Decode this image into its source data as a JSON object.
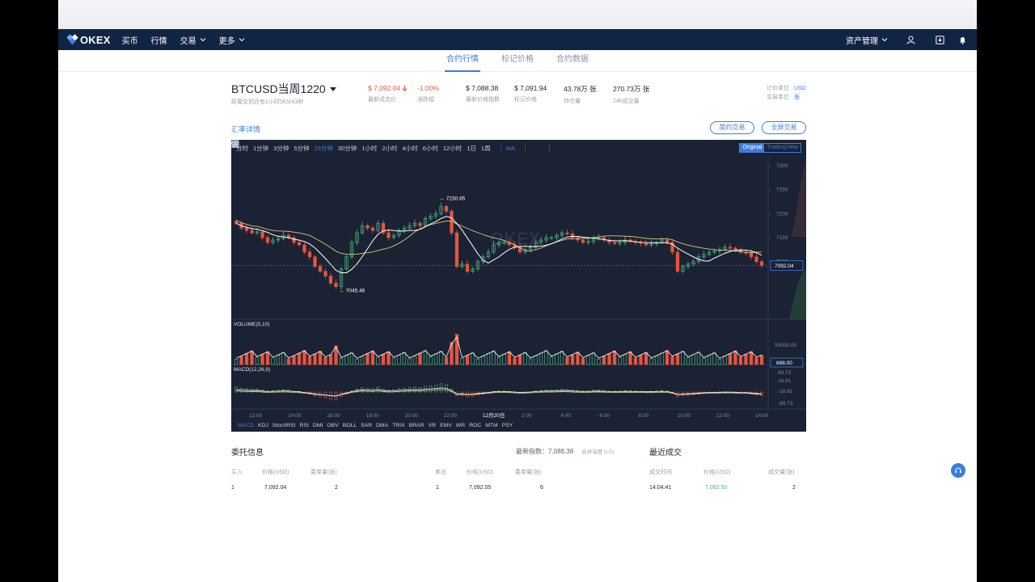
{
  "nav": {
    "logo": "OKEX",
    "items": [
      "买币",
      "行情",
      "交易",
      "更多"
    ],
    "asset_label": "资产管理"
  },
  "subtabs": [
    "合约行情",
    "标记价格",
    "合约数据"
  ],
  "ticker": {
    "symbol": "BTCUSD当周1220",
    "delivery": "距离交割还有1小时56分43秒",
    "stats": [
      {
        "value": "$ 7,092.04",
        "label": "最新成交价"
      },
      {
        "value": "-1.00%",
        "label": "涨跌幅"
      },
      {
        "value": "$ 7,088.38",
        "label": "最新价格指数"
      },
      {
        "value": "$ 7,091.94",
        "label": "标记价格"
      },
      {
        "value": "43.78万 张",
        "label": "持仓量"
      },
      {
        "value": "270.73万 张",
        "label": "24h成交量"
      }
    ],
    "price_unit_label": "计价单位",
    "price_unit": "USD",
    "trade_unit_label": "交易单位",
    "trade_unit": "张"
  },
  "links": {
    "rates": "汇率详情",
    "simple": "简约交易",
    "fullscreen": "全屏交易"
  },
  "chart": {
    "timeframes": [
      "分时",
      "1分钟",
      "3分钟",
      "5分钟",
      "15分钟",
      "30分钟",
      "1小时",
      "2小时",
      "4小时",
      "6小时",
      "12小时",
      "1日",
      "1周"
    ],
    "active_timeframe": "15分钟",
    "ma_label": "MA",
    "view_original": "Original",
    "view_tradingview": "TradingView",
    "volume_label": "VOLUME(5,10)",
    "macd_label": "MACD(12,26,9)",
    "date_label": "12月20日",
    "indicators": [
      "MACD",
      "KDJ",
      "StochRSI",
      "RSI",
      "DMI",
      "OBV",
      "BOLL",
      "SAR",
      "DMA",
      "TRIX",
      "BRAR",
      "VR",
      "EMV",
      "WR",
      "ROC",
      "MTM",
      "PSY"
    ],
    "watermark": "OKEX",
    "colors": {
      "up": "#4fb382",
      "down": "#e55541",
      "accent": "#3b7ddd",
      "bg": "#1a2233"
    }
  },
  "chart_data": {
    "type": "candlestick",
    "ylabel": "",
    "ylim": [
      6980,
      7320
    ],
    "y_ticks": [
      7300,
      7250,
      7200,
      7150,
      7100
    ],
    "x_ticks": [
      "12:00",
      "14:00",
      "16:00",
      "18:00",
      "20:00",
      "22:00",
      "12月20日",
      "2:00",
      "4:00",
      "6:00",
      "8:00",
      "10:00",
      "12:00",
      "14:00"
    ],
    "last_price": "7092.04",
    "high_marker": "7230.65",
    "low_marker": "7045.46",
    "close_values": [
      7180,
      7170,
      7165,
      7160,
      7162,
      7150,
      7140,
      7145,
      7148,
      7155,
      7150,
      7140,
      7135,
      7120,
      7110,
      7090,
      7080,
      7070,
      7055,
      7048,
      7085,
      7110,
      7140,
      7160,
      7175,
      7170,
      7165,
      7180,
      7160,
      7150,
      7155,
      7165,
      7170,
      7175,
      7180,
      7175,
      7190,
      7195,
      7200,
      7215,
      7205,
      7160,
      7090,
      7095,
      7080,
      7085,
      7100,
      7110,
      7120,
      7135,
      7140,
      7140,
      7135,
      7130,
      7120,
      7125,
      7130,
      7140,
      7145,
      7150,
      7150,
      7155,
      7160,
      7158,
      7150,
      7145,
      7140,
      7142,
      7148,
      7150,
      7145,
      7140,
      7138,
      7140,
      7145,
      7142,
      7140,
      7138,
      7135,
      7137,
      7140,
      7145,
      7140,
      7120,
      7080,
      7090,
      7095,
      7100,
      7110,
      7115,
      7120,
      7122,
      7125,
      7130,
      7128,
      7125,
      7120,
      7118,
      7110,
      7100,
      7092
    ],
    "volume": {
      "ylim": [
        0,
        80000
      ],
      "ticks": [
        "50000.00",
        "688.00"
      ]
    },
    "macd": {
      "ticks": [
        "89.73",
        "16.91",
        "-16.91",
        "-89.73"
      ]
    }
  },
  "bottom": {
    "orders_title": "委托信息",
    "latest_index": "最新指数：7,088.38",
    "depth_label": "合并深度",
    "depth_value": "0.01",
    "recent_title": "最近成交",
    "buy_headers": [
      "买入",
      "价格(USD)",
      "委单量(张)"
    ],
    "sell_headers": [
      "卖出",
      "价格(USD)",
      "委单量(张)"
    ],
    "trade_headers": [
      "成交时间",
      "价格(USD)",
      "成交量(张)"
    ],
    "buy_row": [
      "1",
      "7,092.04",
      "2"
    ],
    "sell_row": [
      "1",
      "7,092.05",
      "6"
    ],
    "trade_row": [
      "14:04:41",
      "7,092.50",
      "2"
    ]
  }
}
